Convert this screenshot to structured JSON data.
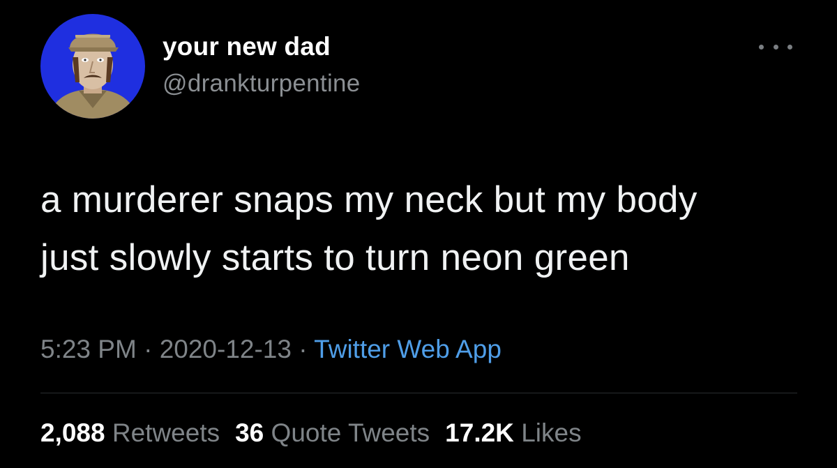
{
  "author": {
    "name": "your new dad",
    "handle": "@drankturpentine",
    "avatar_icon": "profile-portrait-icon"
  },
  "more_icon": "more-options-icon",
  "tweet": {
    "text_line1": "a murderer snaps my neck but my body",
    "text_line2": "just slowly starts to turn neon green"
  },
  "meta": {
    "time": "5:23 PM",
    "separator": " · ",
    "date": "2020-12-13",
    "source": "Twitter Web App"
  },
  "stats": {
    "retweets_count": "2,088",
    "retweets_label": "Retweets",
    "quotes_count": "36",
    "quotes_label": "Quote Tweets",
    "likes_count": "17.2K",
    "likes_label": "Likes"
  },
  "colors": {
    "background": "#000000",
    "link": "#4f9ee8",
    "muted": "#7f8488",
    "avatar_bg": "#1f2fe0"
  }
}
